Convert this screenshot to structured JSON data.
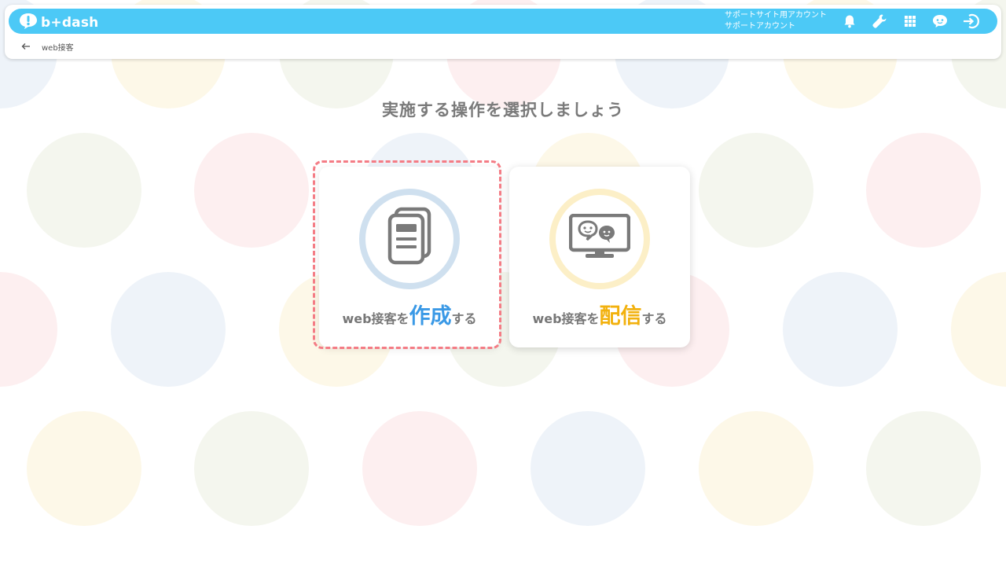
{
  "app": {
    "logo_text": "b+dash",
    "account_line1": "サポートサイト用アカウント",
    "account_line2": "サポートアカウント"
  },
  "toolbar_icons": [
    "bell-icon",
    "wrench-icon",
    "grid-icon",
    "user-chat-icon",
    "logout-icon"
  ],
  "breadcrumb": {
    "back_icon": "arrow-left-icon",
    "label": "web接客"
  },
  "main": {
    "title": "実施する操作を選択しましょう",
    "cards": [
      {
        "icon": "document-icon",
        "prefix": "web接客を",
        "emphasis": "作成",
        "suffix": "する",
        "selected": true,
        "emphasis_color": "#3a99e6"
      },
      {
        "icon": "monitor-chat-icon",
        "prefix": "web接客を",
        "emphasis": "配信",
        "suffix": "する",
        "selected": false,
        "emphasis_color": "#f2b10d"
      }
    ]
  },
  "colors": {
    "topbar": "#4cc9f6",
    "selection_outline": "#f47c85",
    "dot_blue": "#eef3f9",
    "dot_pink": "#fdeff0",
    "dot_yellow": "#fdf8e8",
    "dot_green": "#f4f6ee"
  }
}
